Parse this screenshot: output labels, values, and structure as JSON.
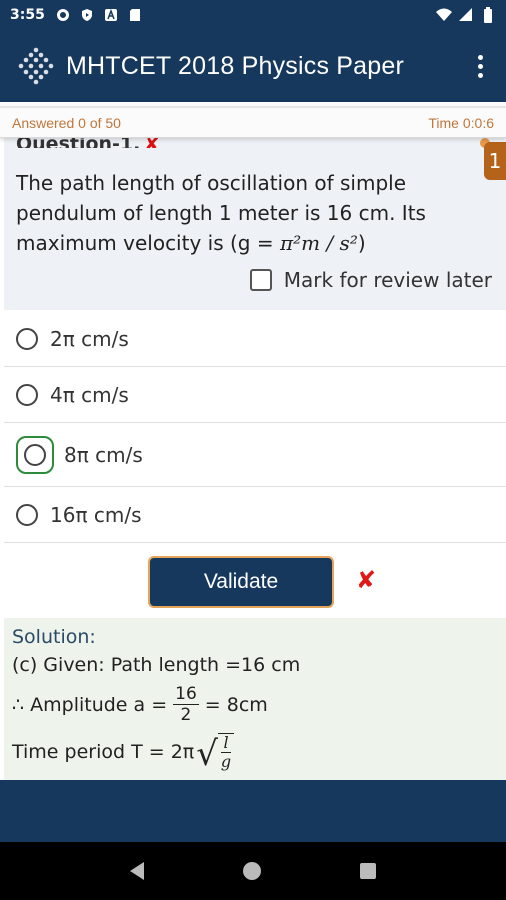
{
  "status": {
    "time": "3:55"
  },
  "app": {
    "title": "MHTCET 2018 Physics Paper"
  },
  "progress": {
    "answered": "Answered 0 of 50",
    "timer": "Time 0:0:6"
  },
  "question": {
    "header": "Question-1.",
    "badge": "1",
    "text_main": "The path length of oscillation of simple pendulum of length 1 meter is 16 cm. Its maximum velocity is (g = ",
    "text_math": "π²m / s²",
    "text_end": ")",
    "review_label": "Mark for review later"
  },
  "options": [
    {
      "label": "2π cm/s",
      "selected": false
    },
    {
      "label": "4π cm/s",
      "selected": false
    },
    {
      "label": "8π cm/s",
      "selected": true
    },
    {
      "label": "16π cm/s",
      "selected": false
    }
  ],
  "validate": {
    "label": "Validate",
    "result_mark": "✘"
  },
  "solution": {
    "title": "Solution:",
    "line1": "(c) Given: Path length =16 cm",
    "line2_prefix": "∴ Amplitude a =",
    "line2_num": "16",
    "line2_den": "2",
    "line2_suffix": "= 8cm",
    "line3_prefix": "Time period T = 2π",
    "line3_num": "l",
    "line3_den": "g"
  }
}
